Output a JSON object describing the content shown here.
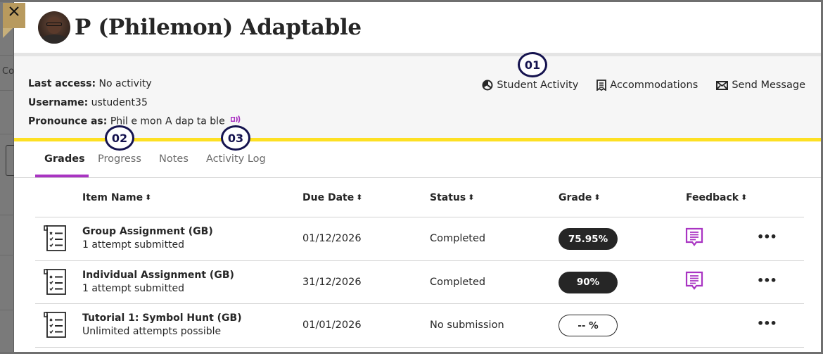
{
  "header": {
    "close_label": "Close",
    "title": "P (Philemon) Adaptable"
  },
  "background": {
    "partial_text": "Co"
  },
  "info": {
    "last_access_label": "Last access:",
    "last_access_value": "No activity",
    "username_label": "Username:",
    "username_value": "ustudent35",
    "pronounce_label": "Pronounce as:",
    "pronounce_value": "Phil e mon A dap ta ble",
    "pronounce_icon": "speaker-icon"
  },
  "actions": [
    {
      "label": "Student Activity",
      "icon": "pie-chart-icon"
    },
    {
      "label": "Accommodations",
      "icon": "document-list-icon"
    },
    {
      "label": "Send Message",
      "icon": "envelope-icon"
    }
  ],
  "callouts": [
    "01",
    "02",
    "03"
  ],
  "tabs": [
    {
      "label": "Grades",
      "active": true
    },
    {
      "label": "Progress",
      "active": false
    },
    {
      "label": "Notes",
      "active": false
    },
    {
      "label": "Activity Log",
      "active": false
    }
  ],
  "table": {
    "columns": [
      "Item Name",
      "Due Date",
      "Status",
      "Grade",
      "Feedback"
    ],
    "sort_icon": "sort-icon",
    "rows": [
      {
        "icon": "assignment-checklist-icon",
        "name": "Group Assignment (GB)",
        "sub": "1 attempt submitted",
        "due": "01/12/2026",
        "status": "Completed",
        "grade": "75.95%",
        "grade_style": "filled",
        "has_feedback": true,
        "more": "•••"
      },
      {
        "icon": "assignment-checklist-icon",
        "name": "Individual Assignment (GB)",
        "sub": "1 attempt submitted",
        "due": "31/12/2026",
        "status": "Completed",
        "grade": "90%",
        "grade_style": "filled",
        "has_feedback": true,
        "more": "•••"
      },
      {
        "icon": "assignment-checklist-icon",
        "name": "Tutorial 1: Symbol Hunt (GB)",
        "sub": "Unlimited attempts possible",
        "due": "01/01/2026",
        "status": "No submission",
        "grade": "-- %",
        "grade_style": "empty",
        "has_feedback": false,
        "more": "•••"
      }
    ]
  },
  "colors": {
    "accent_yellow": "#fde023",
    "tab_underline": "#a934c2",
    "feedback_purple": "#a934c2",
    "callout_navy": "#15134f",
    "close_bg": "#b89a5e",
    "pill_dark": "#262626"
  }
}
